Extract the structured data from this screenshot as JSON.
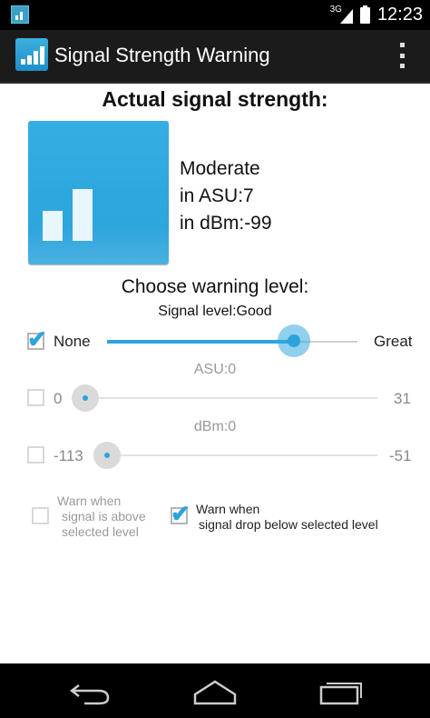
{
  "status_bar": {
    "network_type": "3G",
    "time": "12:23"
  },
  "action_bar": {
    "title": "Signal Strength Warning",
    "icons": {
      "app": "signal-bars-icon",
      "overflow": "overflow-menu-icon"
    }
  },
  "signal": {
    "heading": "Actual signal strength:",
    "quality": "Moderate",
    "asu_text": "in ASU:7",
    "dbm_text": "in dBm:-99"
  },
  "warning": {
    "choose_label": "Choose warning level:",
    "level_label": "Signal level:Good",
    "signal_level": {
      "checked": true,
      "min_label": "None",
      "max_label": "Great",
      "value_fraction": 0.74
    },
    "asu": {
      "label": "ASU:0",
      "checked": false,
      "min_label": "0",
      "max_label": "31",
      "value_fraction": 0
    },
    "dbm": {
      "label": "dBm:0",
      "checked": false,
      "min_label": "-113",
      "max_label": "-51",
      "value_fraction": 0
    },
    "warn_above": {
      "checked": false,
      "line1": "Warn when",
      "line2": "signal is above",
      "line3": "selected level"
    },
    "warn_below": {
      "checked": true,
      "line1": "Warn when",
      "line2": "signal drop below selected level"
    }
  },
  "nav_bar": {
    "icons": [
      "back-icon",
      "home-icon",
      "recent-apps-icon"
    ]
  }
}
